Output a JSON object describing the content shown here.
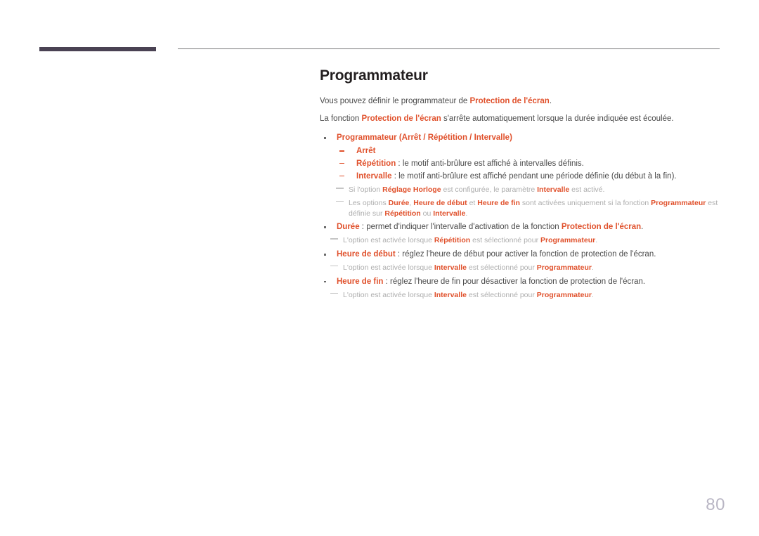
{
  "page": {
    "number": "80",
    "title": "Programmateur"
  },
  "colors": {
    "accent_orange": "#e0512c",
    "title_dark": "#231f20",
    "body_gray": "#4a4a4a",
    "note_gray": "#adadad",
    "rule_thick": "#4a4253",
    "rule_thin": "#77777a",
    "page_number": "#b9b6c4"
  },
  "intro": {
    "line1": {
      "before": "Vous pouvez définir le programmateur de ",
      "keyword": "Protection de l'écran",
      "after": "."
    },
    "line2": {
      "before": "La fonction ",
      "keyword": "Protection de l'écran",
      "after": " s'arrête automatiquement lorsque la durée indiquée est écoulée."
    }
  },
  "list": {
    "item1": {
      "label": "Programmateur",
      "options_open": " (",
      "option_a": "Arrêt",
      "sep1": " / ",
      "option_b": "Répétition",
      "sep2": " / ",
      "option_c": "Intervalle",
      "options_close": ")",
      "sub": [
        {
          "label": "Arrêt",
          "text": ""
        },
        {
          "label": "Répétition",
          "text": " : le motif anti-brûlure est affiché à intervalles définis."
        },
        {
          "label": "Intervalle",
          "text": " : le motif anti-brûlure est affiché pendant une période définie (du début à la fin)."
        }
      ]
    },
    "note1": {
      "t1": "Si l'option ",
      "b1": "Réglage Horloge",
      "t2": " est configurée, le paramètre ",
      "b2": "Intervalle",
      "t3": " est activé."
    },
    "note2": {
      "t1": "Les options ",
      "b1": "Durée",
      "t2": ", ",
      "b2": "Heure de début",
      "t3": " et ",
      "b3": "Heure de fin",
      "t4": " sont activées uniquement si la fonction ",
      "b4": "Programmateur",
      "t5": " est définie sur ",
      "b5": "Répétition",
      "t6": " ou ",
      "b6": "Intervalle",
      "t7": "."
    },
    "item2": {
      "label": "Durée",
      "text_before": " : permet d'indiquer l'intervalle d'activation de la fonction ",
      "keyword": "Protection de l'écran",
      "text_after": "."
    },
    "note3": {
      "t1": "L'option est activée lorsque ",
      "b1": "Répétition",
      "t2": " est sélectionné pour ",
      "b2": "Programmateur",
      "t3": "."
    },
    "item3": {
      "label": "Heure de début",
      "text": " : réglez l'heure de début pour activer la fonction de protection de l'écran."
    },
    "note4": {
      "t1": "L'option est activée lorsque ",
      "b1": "Intervalle",
      "t2": " est sélectionné pour ",
      "b2": "Programmateur",
      "t3": "."
    },
    "item4": {
      "label": "Heure de fin",
      "text": " : réglez l'heure de fin pour désactiver la fonction de protection de l'écran."
    },
    "note5": {
      "t1": "L'option est activée lorsque ",
      "b1": "Intervalle",
      "t2": " est sélectionné pour ",
      "b2": "Programmateur",
      "t3": "."
    }
  }
}
